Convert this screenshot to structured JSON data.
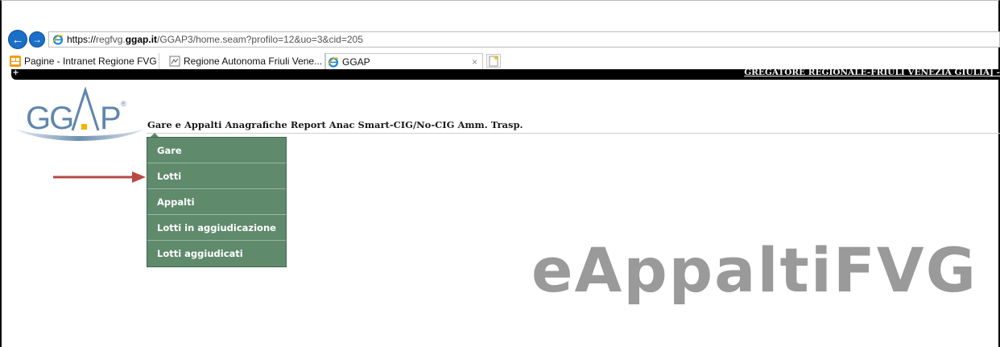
{
  "browser": {
    "address": {
      "scheme": "https://",
      "subdomain": "regfvg.",
      "domain": "ggap.it",
      "path": "/GGAP3/home.seam?profilo=12&uo=3&cid=205"
    },
    "tabs": [
      {
        "label": "Pagine - Intranet Regione FVG",
        "icon": "sharepoint-icon"
      },
      {
        "label": "Regione Autonoma Friuli Vene...",
        "icon": "page-icon"
      },
      {
        "label": "GGAP",
        "icon": "ie-icon",
        "active": true
      }
    ],
    "tab_close_symbol": "×"
  },
  "banner": {
    "plus": "+",
    "text": "GREGATORE REGIONALE-FRIULI VENEZIA GIULIA] -"
  },
  "logo": {
    "text": "GGAP",
    "registered": "®"
  },
  "main_menu": [
    {
      "label": "Gare e Appalti"
    },
    {
      "label": "Anagrafiche"
    },
    {
      "label": "Report"
    },
    {
      "label": "Anac"
    },
    {
      "label": "Smart-CIG/No-CIG"
    },
    {
      "label": "Amm. Trasp."
    }
  ],
  "dropdown": [
    {
      "label": "Gare"
    },
    {
      "label": "Lotti",
      "highlighted_by_arrow": true
    },
    {
      "label": "Appalti"
    },
    {
      "label": "Lotti in aggiudicazione"
    },
    {
      "label": "Lotti aggiudicati"
    }
  ],
  "wordmark": "eAppaltiFVG",
  "colors": {
    "dropdown_bg": "#5f8a6b",
    "arrow": "#b84a45",
    "wordmark": "#9a9a9a",
    "nav_button": "#1a6fc8"
  }
}
